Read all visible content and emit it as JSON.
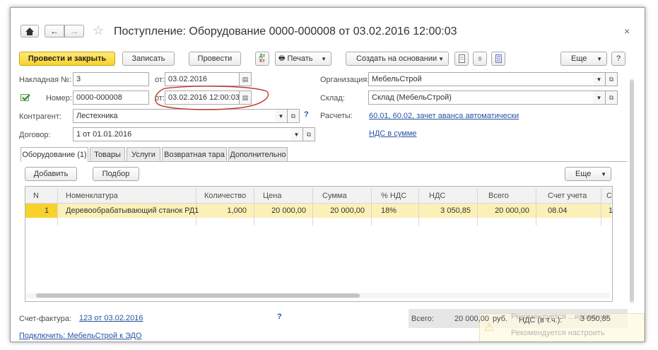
{
  "window": {
    "title": "Поступление: Оборудование 0000-000008 от 03.02.2016 12:00:03",
    "close_glyph": "×"
  },
  "toolbar": {
    "post_close": "Провести и закрыть",
    "save": "Записать",
    "post": "Провести",
    "print": "Печать",
    "create_based": "Создать на основании",
    "more": "Еще",
    "help": "?"
  },
  "form": {
    "invoice_label": "Накладная №:",
    "invoice_number": "3",
    "invoice_date_label": "от:",
    "invoice_date": "03.02.2016",
    "number_label": "Номер:",
    "number": "0000-000008",
    "date_label": "от:",
    "date": "03.02.2016 12:00:03",
    "counterparty_label": "Контрагент:",
    "counterparty": "Лестехника",
    "contract_label": "Договор:",
    "contract": "1 от 01.01.2016",
    "org_label": "Организация:",
    "org": "МебельСтрой",
    "warehouse_label": "Склад:",
    "warehouse": "Склад (МебельСтрой)",
    "settlements_label": "Расчеты:",
    "settlements_link": "60.01, 60.02, зачет аванса автоматически",
    "vat_link": "НДС в сумме",
    "question": "?"
  },
  "tabs": [
    "Оборудование (1)",
    "Товары",
    "Услуги",
    "Возвратная тара",
    "Дополнительно"
  ],
  "table_toolbar": {
    "add": "Добавить",
    "pick": "Подбор",
    "more": "Еще"
  },
  "table": {
    "columns": [
      "N",
      "Номенклатура",
      "Количество",
      "Цена",
      "Сумма",
      "% НДС",
      "НДС",
      "Всего",
      "Счет учета",
      "С"
    ],
    "rows": [
      [
        "1",
        "Деревообрабатывающий станок РД1",
        "1,000",
        "20 000,00",
        "20 000,00",
        "18%",
        "3 050,85",
        "20 000,00",
        "08.04",
        "1"
      ]
    ]
  },
  "footer": {
    "invoice_label": "Счет-фактура:",
    "invoice_link": "123 от 03.02.2016",
    "question": "?",
    "total_label": "Всего:",
    "total_value": "20 000,00",
    "currency": "руб.",
    "vat_label": "НДС (в т.ч.):",
    "vat_value": "3 050,85",
    "faded_top": "Рекомендуется ...ирование",
    "faded_bottom": "Рекомендуется настроить",
    "edo_link": "Подключить: МебельСтрой к ЭДО"
  },
  "colors": {
    "accent_yellow": "#f7d22c",
    "selected_row": "#fbf1b8",
    "link": "#2653a3",
    "annotation": "#c0392b"
  }
}
